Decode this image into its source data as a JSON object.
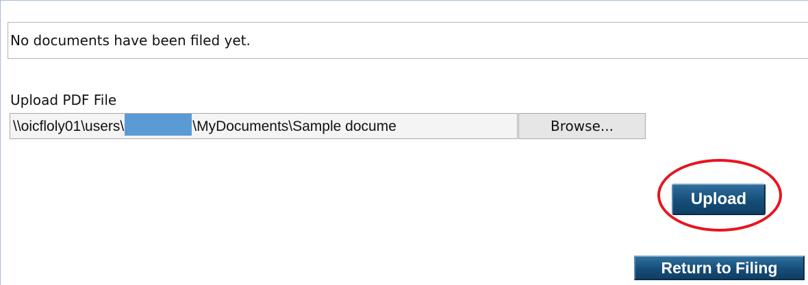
{
  "documents": {
    "empty_message": "No documents have been filed yet."
  },
  "upload": {
    "label": "Upload PDF File",
    "file_path_prefix": "\\\\oicfloly01\\users\\",
    "file_path_suffix": "\\MyDocuments\\Sample docume",
    "redaction_color": "#5b9bd5",
    "browse_label": "Browse...",
    "upload_label": "Upload"
  },
  "footer": {
    "return_label": "Return to Filing"
  },
  "colors": {
    "button_bg": "#164d78",
    "highlight_ring": "#e8141e"
  }
}
